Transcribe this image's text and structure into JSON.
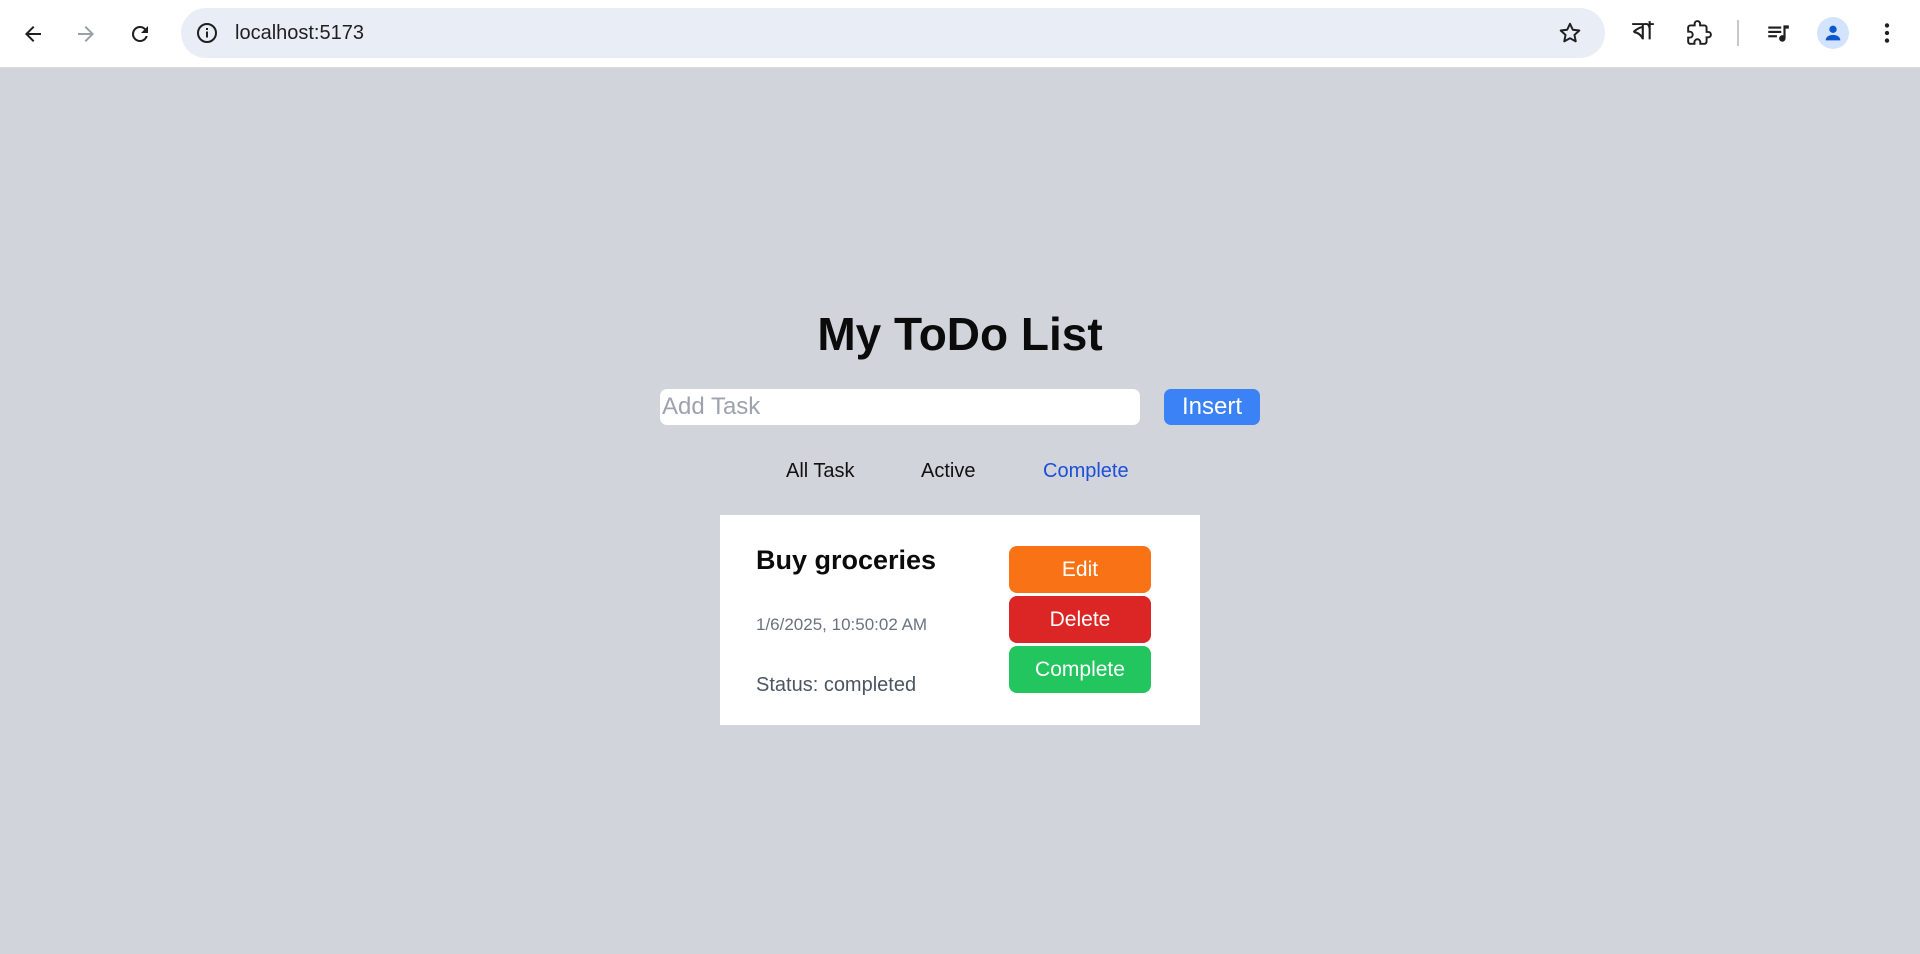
{
  "browser": {
    "url": "localhost:5173",
    "translate_glyph": "বা"
  },
  "app": {
    "title": "My ToDo List",
    "input_placeholder": "Add Task",
    "input_value": "",
    "insert_label": "Insert",
    "filters": [
      {
        "label": "All Task",
        "selected": false
      },
      {
        "label": "Active",
        "selected": false
      },
      {
        "label": "Complete",
        "selected": true
      }
    ],
    "tasks": [
      {
        "title": "Buy groceries",
        "date": "1/6/2025, 10:50:02 AM",
        "status": "Status: completed",
        "edit_label": "Edit",
        "delete_label": "Delete",
        "complete_label": "Complete"
      }
    ]
  },
  "colors": {
    "page_bg": "#d1d5db",
    "insert": "#3b82f6",
    "edit": "#f97316",
    "delete": "#dc2626",
    "complete": "#22c55e",
    "active_filter": "#1d4ed8"
  }
}
